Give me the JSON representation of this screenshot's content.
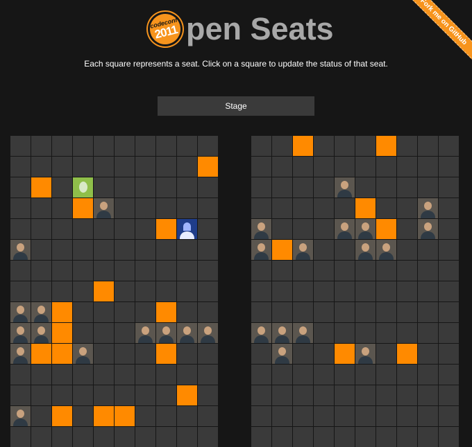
{
  "header": {
    "logo_line1": "codeconf",
    "logo_line2": "2011",
    "title": "pen Seats",
    "subtitle": "Each square represents a seat. Click on a square to update the status of that seat.",
    "ribbon": "Fork me on GitHub"
  },
  "stage": {
    "label": "Stage"
  },
  "colors": {
    "background": "#161616",
    "empty_seat": "#3a3a3a",
    "occupied_seat": "#ff8a00",
    "logo": "#f7941d"
  },
  "legend": {
    "empty": ".",
    "occupied": "O",
    "avatar": "A",
    "egg_avatar": "E",
    "blue_avatar": "B"
  },
  "sections": [
    {
      "name": "left",
      "rows": [
        "..........",
        ".........O",
        ".O.E......",
        "...OA.....",
        ".......OB.",
        "A.........",
        "..........",
        "....O.....",
        "AAO....O..",
        "AAO...AAAA",
        "AOOA...O..",
        "..........",
        "........O.",
        "A.O.OO....",
        ".........."
      ]
    },
    {
      "name": "right",
      "rows": [
        "..O...O...",
        "..........",
        "....A.....",
        ".....O..A.",
        "A...AAO.A.",
        "AOA..AA...",
        "..........",
        "..........",
        "..........",
        "AAA.......",
        ".A..OA.O..",
        "..........",
        "..........",
        "..........",
        ".........."
      ]
    }
  ]
}
